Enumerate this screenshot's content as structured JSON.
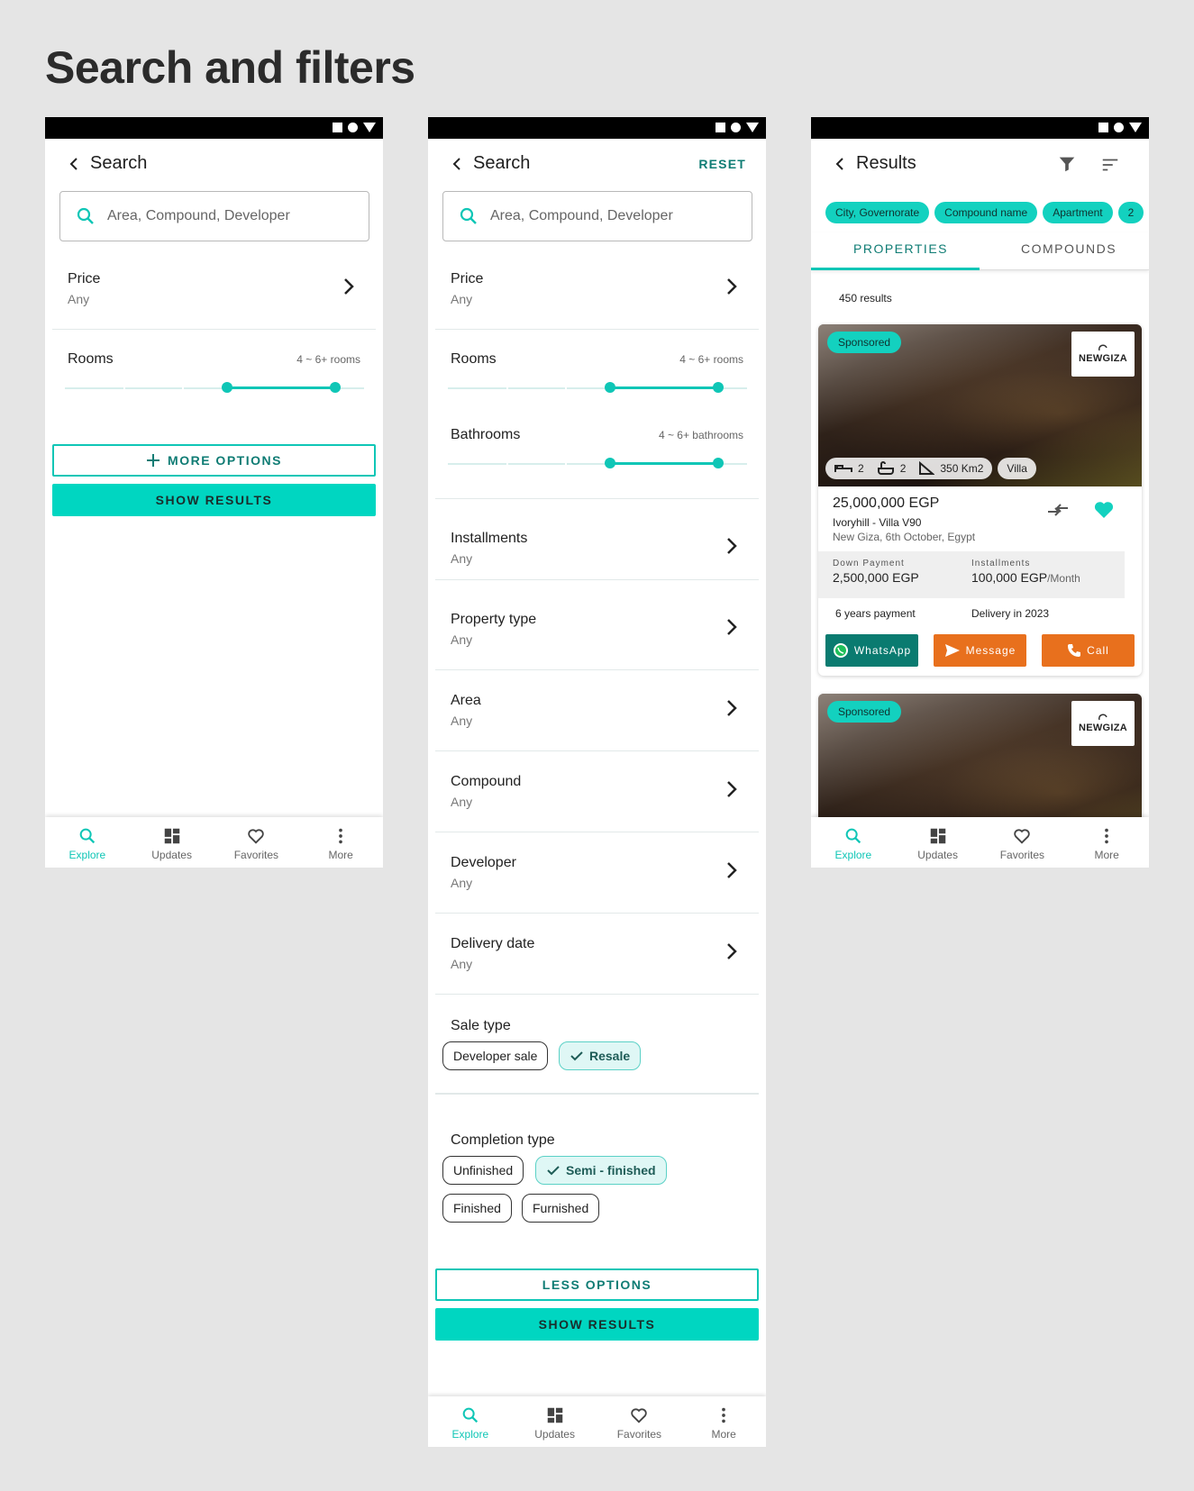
{
  "page_title": "Search and filters",
  "colors": {
    "accent": "#00d6c1",
    "accent_dark": "#0f7c74",
    "whatsapp": "#0a7b70",
    "orange": "#e8701d"
  },
  "nav": {
    "explore": "Explore",
    "updates": "Updates",
    "favorites": "Favorites",
    "more": "More"
  },
  "screen1": {
    "title": "Search",
    "search_placeholder": "Area, Compound, Developer",
    "price_label": "Price",
    "price_value": "Any",
    "rooms_label": "Rooms",
    "rooms_value": "4 ~ 6+ rooms",
    "more_options": "MORE OPTIONS",
    "show_results": "SHOW RESULTS"
  },
  "screen2": {
    "title": "Search",
    "reset": "RESET",
    "search_placeholder": "Area, Compound, Developer",
    "price_label": "Price",
    "price_value": "Any",
    "rooms_label": "Rooms",
    "rooms_value": "4 ~ 6+ rooms",
    "bathrooms_label": "Bathrooms",
    "bathrooms_value": "4 ~ 6+ bathrooms",
    "rows": [
      {
        "label": "Installments",
        "value": "Any"
      },
      {
        "label": "Property type",
        "value": "Any"
      },
      {
        "label": "Area",
        "value": "Any"
      },
      {
        "label": "Compound",
        "value": "Any"
      },
      {
        "label": "Developer",
        "value": "Any"
      },
      {
        "label": "Delivery date",
        "value": "Any"
      }
    ],
    "sale_type_label": "Sale type",
    "sale_types": [
      "Developer sale",
      "Resale"
    ],
    "sale_type_selected": "Resale",
    "completion_label": "Completion type",
    "completion_types": [
      "Unfinished",
      "Semi - finished",
      "Finished",
      "Furnished"
    ],
    "completion_selected": "Semi - finished",
    "less_options": "LESS OPTIONS",
    "show_results": "SHOW RESULTS"
  },
  "screen3": {
    "title": "Results",
    "tags": [
      "City, Governorate",
      "Compound name",
      "Apartment",
      "2"
    ],
    "tab_properties": "PROPERTIES",
    "tab_compounds": "COMPOUNDS",
    "result_count": "450 results",
    "card": {
      "sponsored": "Sponsored",
      "logo": "NEWGIZA",
      "beds": "2",
      "baths": "2",
      "area": "350 Km2",
      "type": "Villa",
      "price": "25,000,000 EGP",
      "name": "Ivoryhill - Villa V90",
      "location": "New Giza, 6th October, Egypt",
      "down_payment_label": "Down Payment",
      "down_payment": "2,500,000 EGP",
      "installments_label": "Installments",
      "installments": "100,000 EGP",
      "installments_unit": "/Month",
      "years": "6 years payment",
      "delivery": "Delivery in 2023",
      "whatsapp": "WhatsApp",
      "message": "Message",
      "call": "Call"
    },
    "card2": {
      "sponsored": "Sponsored",
      "logo": "NEWGIZA"
    }
  }
}
